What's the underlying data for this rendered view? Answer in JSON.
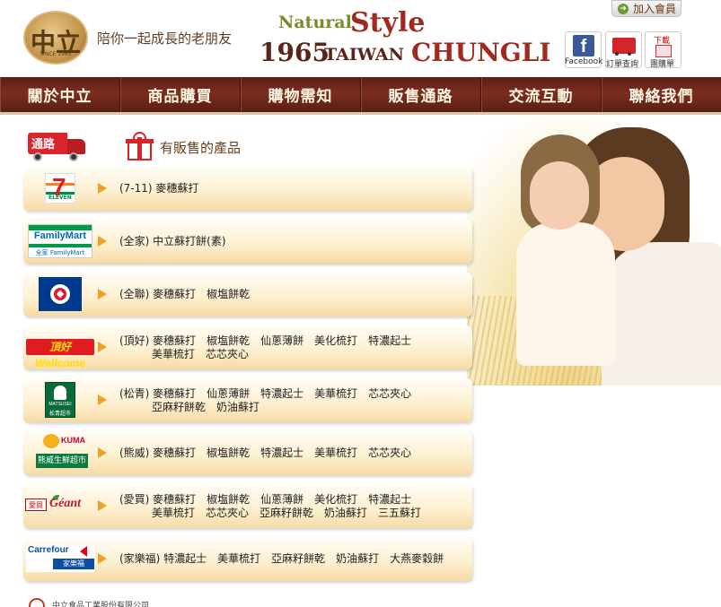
{
  "header": {
    "logo_mark": "中立",
    "logo_sub": "SINCE 1965",
    "slogan": "陪你一起成長的老朋友",
    "brand_natural": "Natural",
    "brand_style": "Style",
    "brand_year": "1965",
    "brand_taiwan": "TAIWAN",
    "brand_chungli": "CHUNGLI",
    "join_label": "加入會員",
    "quick_links": [
      {
        "label": "Facebook",
        "icon": "facebook-icon"
      },
      {
        "label": "訂單查詢",
        "icon": "order-truck-icon"
      },
      {
        "label": "團購單",
        "icon": "download-doc-icon",
        "badge": "下載"
      }
    ]
  },
  "nav": {
    "items": [
      "關於中立",
      "商品購買",
      "購物需知",
      "販售通路",
      "交流互動",
      "聯絡我們"
    ]
  },
  "section": {
    "badge": "通路",
    "title": "有販售的產品"
  },
  "logos": {
    "s711_seven": "7",
    "s711_eleven": "ELEVEN",
    "fm_name": "FamilyMart",
    "fm_sub": "全家 FamilyMart",
    "wel_name": "頂好Wellcome",
    "ms_t1": "MATSUSEI",
    "ms_t2": "松青超市",
    "kuma_name": "KUMA",
    "kuma_bar": "熊威生鮮超市",
    "geant_ai": "愛買",
    "geant_name": "Géant",
    "cf_name": "Carrefour",
    "cf_bar": "家樂福"
  },
  "rows": [
    {
      "store": "7-11",
      "text": "(7-11) 麥穗蘇打"
    },
    {
      "store": "FamilyMart",
      "text": "(全家) 中立蘇打餅(素)"
    },
    {
      "store": "PX Mart",
      "text": "(全聯) 麥穗蘇打　椒塩餅乾"
    },
    {
      "store": "Wellcome",
      "text": "(頂好) 麥穗蘇打　椒塩餅乾　仙蔥薄餅　美化梳打　特濃起士\n　　　美華梳打　芯芯夾心"
    },
    {
      "store": "Matsusei",
      "text": "(松青) 麥穗蘇打　仙蔥薄餅　特濃起士　美華梳打　芯芯夾心\n　　　亞麻籽餅乾　奶油蘇打"
    },
    {
      "store": "Kuma",
      "text": "(熊威) 麥穗蘇打　椒塩餅乾　特濃起士　美華梳打　芯芯夾心"
    },
    {
      "store": "Geant",
      "text": "(愛買) 麥穗蘇打　椒塩餅乾　仙蔥薄餅　美化梳打　特濃起士\n　　　美華梳打　芯芯夾心　亞麻籽餅乾　奶油蘇打　三五蘇打"
    },
    {
      "store": "Carrefour",
      "text": "(家樂福) 特濃起士　美華梳打　亞麻籽餅乾　奶油蘇打　大燕麥穀餅"
    }
  ],
  "footer": {
    "company": "中立食品工業股份有限公司"
  },
  "colors": {
    "nav_bg": "#6a2418",
    "brand_red": "#a12a1e",
    "brand_green": "#7a8c2a",
    "row_gradient_end": "#f7dba5",
    "arrow": "#f0a11f"
  }
}
